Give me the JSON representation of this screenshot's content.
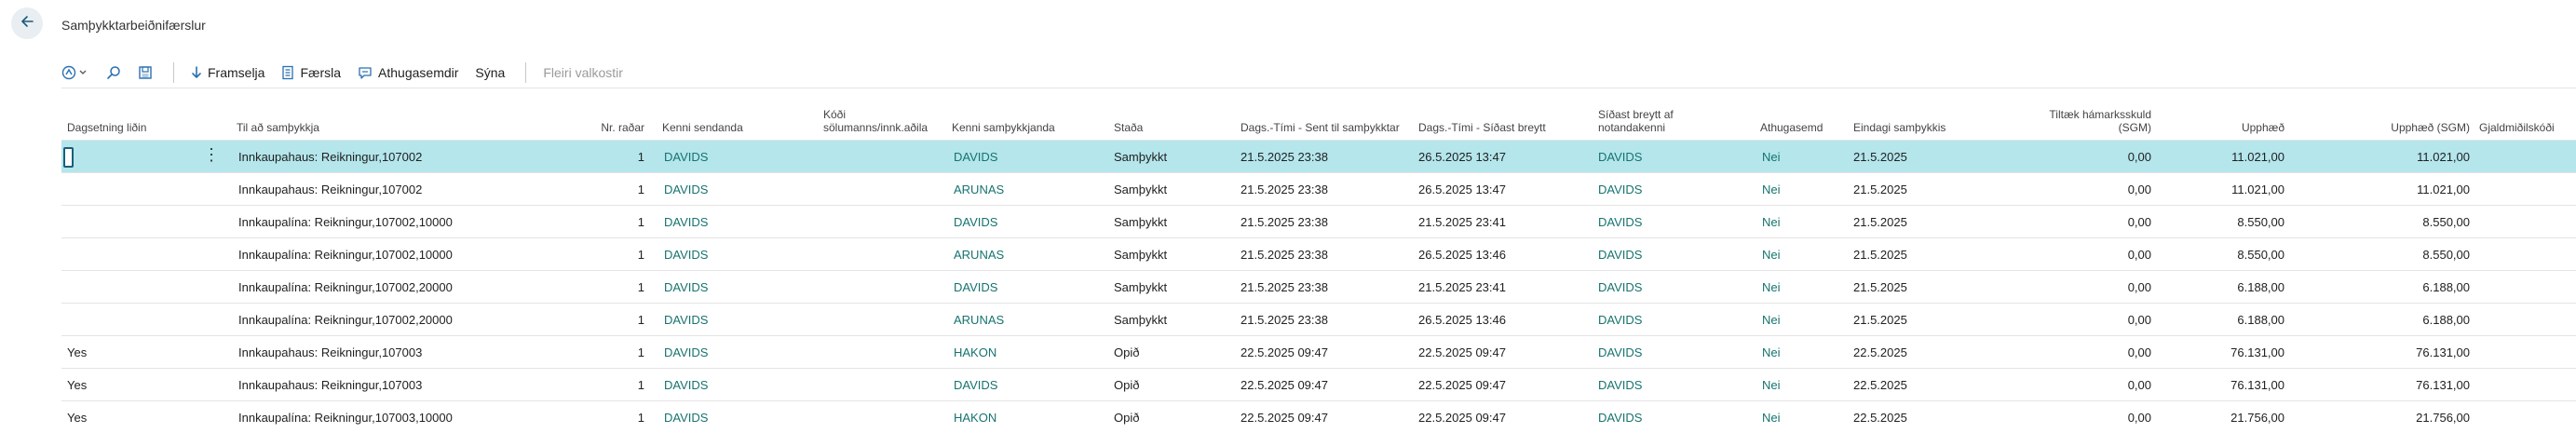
{
  "page": {
    "title": "Samþykktarbeiðnifærslur"
  },
  "toolbar": {
    "framselja": "Framselja",
    "faersla": "Færsla",
    "athugasemdir": "Athugasemdir",
    "syna": "Sýna",
    "fleiri": "Fleiri valkostir"
  },
  "columns": {
    "dagsetning": "Dagsetning liðin",
    "til": "Til að samþykkja",
    "nr": "Nr. raðar",
    "kenni_sendanda": "Kenni sendanda",
    "kodi_1": "Kóði",
    "kodi_2": "sölumanns/innk.aðila",
    "kenni_sam": "Kenni samþykkjanda",
    "stada": "Staða",
    "sent": "Dags.-Tími - Sent til samþykktar",
    "breytt": "Dags.-Tími - Síðast breytt",
    "sidast_1": "Síðast breytt af",
    "sidast_2": "notandakenni",
    "athugasemd": "Athugasemd",
    "eindagi": "Eindagi samþykkis",
    "tiltaek_1": "Tiltæk hámarksskuld",
    "tiltaek_2": "(SGM)",
    "upphaed": "Upphæð",
    "upphaed_sgm": "Upphæð (SGM)",
    "gjald": "Gjaldmiðilskóði"
  },
  "rows": [
    {
      "dag": "",
      "til": "Innkaupahaus: Reikningur,107002",
      "nr": "1",
      "send": "DAVIDS",
      "kodi": "",
      "sam": "DAVIDS",
      "stada": "Samþykkt",
      "sent": "21.5.2025 23:38",
      "breytt": "26.5.2025 13:47",
      "af": "DAVIDS",
      "ath": "Nei",
      "eind": "21.5.2025",
      "tilt": "0,00",
      "upp": "11.021,00",
      "upps": "11.021,00",
      "gj": ""
    },
    {
      "dag": "",
      "til": "Innkaupahaus: Reikningur,107002",
      "nr": "1",
      "send": "DAVIDS",
      "kodi": "",
      "sam": "ARUNAS",
      "stada": "Samþykkt",
      "sent": "21.5.2025 23:38",
      "breytt": "26.5.2025 13:47",
      "af": "DAVIDS",
      "ath": "Nei",
      "eind": "21.5.2025",
      "tilt": "0,00",
      "upp": "11.021,00",
      "upps": "11.021,00",
      "gj": ""
    },
    {
      "dag": "",
      "til": "Innkaupalína: Reikningur,107002,10000",
      "nr": "1",
      "send": "DAVIDS",
      "kodi": "",
      "sam": "DAVIDS",
      "stada": "Samþykkt",
      "sent": "21.5.2025 23:38",
      "breytt": "21.5.2025 23:41",
      "af": "DAVIDS",
      "ath": "Nei",
      "eind": "21.5.2025",
      "tilt": "0,00",
      "upp": "8.550,00",
      "upps": "8.550,00",
      "gj": ""
    },
    {
      "dag": "",
      "til": "Innkaupalína: Reikningur,107002,10000",
      "nr": "1",
      "send": "DAVIDS",
      "kodi": "",
      "sam": "ARUNAS",
      "stada": "Samþykkt",
      "sent": "21.5.2025 23:38",
      "breytt": "26.5.2025 13:46",
      "af": "DAVIDS",
      "ath": "Nei",
      "eind": "21.5.2025",
      "tilt": "0,00",
      "upp": "8.550,00",
      "upps": "8.550,00",
      "gj": ""
    },
    {
      "dag": "",
      "til": "Innkaupalína: Reikningur,107002,20000",
      "nr": "1",
      "send": "DAVIDS",
      "kodi": "",
      "sam": "DAVIDS",
      "stada": "Samþykkt",
      "sent": "21.5.2025 23:38",
      "breytt": "21.5.2025 23:41",
      "af": "DAVIDS",
      "ath": "Nei",
      "eind": "21.5.2025",
      "tilt": "0,00",
      "upp": "6.188,00",
      "upps": "6.188,00",
      "gj": ""
    },
    {
      "dag": "",
      "til": "Innkaupalína: Reikningur,107002,20000",
      "nr": "1",
      "send": "DAVIDS",
      "kodi": "",
      "sam": "ARUNAS",
      "stada": "Samþykkt",
      "sent": "21.5.2025 23:38",
      "breytt": "26.5.2025 13:46",
      "af": "DAVIDS",
      "ath": "Nei",
      "eind": "21.5.2025",
      "tilt": "0,00",
      "upp": "6.188,00",
      "upps": "6.188,00",
      "gj": ""
    },
    {
      "dag": "Yes",
      "til": "Innkaupahaus: Reikningur,107003",
      "nr": "1",
      "send": "DAVIDS",
      "kodi": "",
      "sam": "HAKON",
      "stada": "Opið",
      "sent": "22.5.2025 09:47",
      "breytt": "22.5.2025 09:47",
      "af": "DAVIDS",
      "ath": "Nei",
      "eind": "22.5.2025",
      "tilt": "0,00",
      "upp": "76.131,00",
      "upps": "76.131,00",
      "gj": ""
    },
    {
      "dag": "Yes",
      "til": "Innkaupahaus: Reikningur,107003",
      "nr": "1",
      "send": "DAVIDS",
      "kodi": "",
      "sam": "DAVIDS",
      "stada": "Opið",
      "sent": "22.5.2025 09:47",
      "breytt": "22.5.2025 09:47",
      "af": "DAVIDS",
      "ath": "Nei",
      "eind": "22.5.2025",
      "tilt": "0,00",
      "upp": "76.131,00",
      "upps": "76.131,00",
      "gj": ""
    },
    {
      "dag": "Yes",
      "til": "Innkaupalína: Reikningur,107003,10000",
      "nr": "1",
      "send": "DAVIDS",
      "kodi": "",
      "sam": "HAKON",
      "stada": "Opið",
      "sent": "22.5.2025 09:47",
      "breytt": "22.5.2025 09:47",
      "af": "DAVIDS",
      "ath": "Nei",
      "eind": "22.5.2025",
      "tilt": "0,00",
      "upp": "21.756,00",
      "upps": "21.756,00",
      "gj": ""
    }
  ],
  "selected_row": 0,
  "colors": {
    "accent": "#16736f",
    "selected_row": "#b4e6ec",
    "back_button_bg": "#e8eef2"
  },
  "icons": {
    "back": "arrow-left-icon",
    "filter": "filter-chevron-icon",
    "search": "search-icon",
    "layout": "layout-icon",
    "framselja": "arrow-down-icon",
    "faersla": "document-icon",
    "athugasemdir": "comment-icon",
    "row_menu": "more-vertical-icon"
  }
}
